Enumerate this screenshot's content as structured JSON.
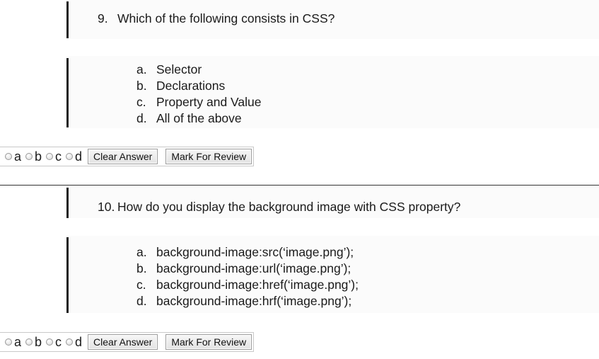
{
  "questions": [
    {
      "number": "9.",
      "text": "Which of the following consists in CSS?",
      "options": [
        {
          "letter": "a.",
          "text": "Selector"
        },
        {
          "letter": "b.",
          "text": "Declarations"
        },
        {
          "letter": "c.",
          "text": "Property and Value"
        },
        {
          "letter": "d.",
          "text": "All of the above"
        }
      ],
      "answer_choices": [
        "a",
        "b",
        "c",
        "d"
      ],
      "clear_label": "Clear Answer",
      "review_label": "Mark For Review"
    },
    {
      "number": "10.",
      "text": "How do you display the background image with CSS property?",
      "options": [
        {
          "letter": "a.",
          "text": "background-image:src(‘image.png’);"
        },
        {
          "letter": "b.",
          "text": "background-image:url(‘image.png’);"
        },
        {
          "letter": "c.",
          "text": "background-image:href(‘image.png’);"
        },
        {
          "letter": "d.",
          "text": "background-image:hrf(‘image.png’);"
        }
      ],
      "answer_choices": [
        "a",
        "b",
        "c",
        "d"
      ],
      "clear_label": "Clear Answer",
      "review_label": "Mark For Review"
    }
  ]
}
